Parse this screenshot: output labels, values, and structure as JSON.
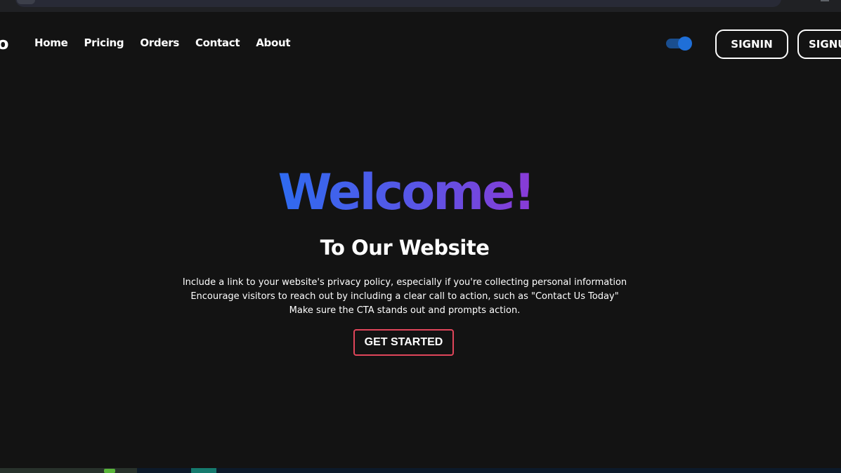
{
  "brand": {
    "logo_text": "o"
  },
  "nav": {
    "items": [
      {
        "label": "Home"
      },
      {
        "label": "Pricing"
      },
      {
        "label": "Orders"
      },
      {
        "label": "Contact"
      },
      {
        "label": "About"
      }
    ]
  },
  "header": {
    "theme_toggle": {
      "state": "on",
      "color": "#1f6fd8"
    },
    "signin_label": "SIGNIN",
    "signup_label": "SIGNU"
  },
  "hero": {
    "title": "Welcome!",
    "subtitle": "To Our Website",
    "lines": [
      "Include a link to your website's privacy policy, especially if you're collecting personal information",
      "Encourage visitors to reach out by including a clear call to action, such as \"Contact Us Today\"",
      "Make sure the CTA stands out and prompts action."
    ],
    "cta_label": "GET STARTED",
    "gradient": [
      "#2e6bf0",
      "#8a3ad6"
    ],
    "cta_border_color": "#e0455a"
  }
}
